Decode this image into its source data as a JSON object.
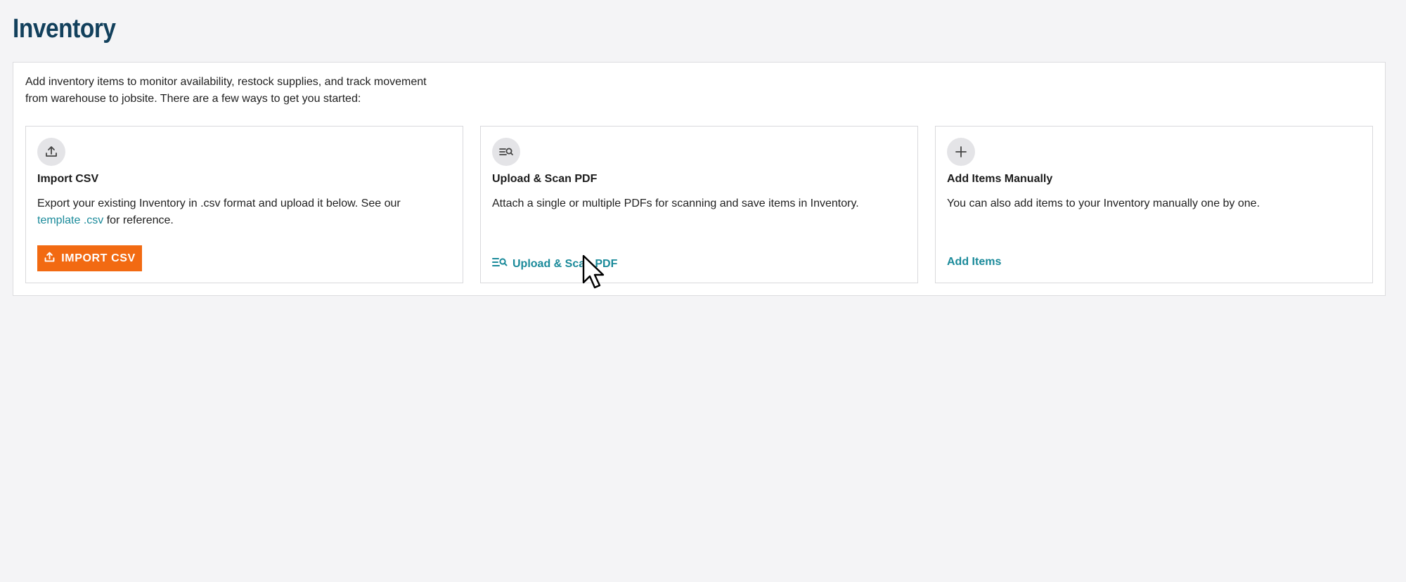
{
  "page": {
    "title": "Inventory"
  },
  "intro": {
    "line1": "Add inventory items to monitor availability, restock supplies, and track movement",
    "line2": "from warehouse to jobsite. There are a few ways to get you started:"
  },
  "cards": {
    "import_csv": {
      "icon": "upload-icon",
      "title": "Import CSV",
      "desc_before_link": "Export your existing Inventory in .csv format and upload it below. See our",
      "link_text": "template .csv",
      "desc_after_link": " for reference.",
      "button_label": "IMPORT CSV",
      "button_icon": "upload-icon"
    },
    "upload_scan": {
      "icon": "scan-list-icon",
      "title": "Upload & Scan PDF",
      "desc": "Attach a single or multiple PDFs for scanning and save items in Inventory.",
      "action_label": "Upload & Scan PDF",
      "action_icon": "scan-list-icon"
    },
    "add_manual": {
      "icon": "plus-icon",
      "title": "Add Items Manually",
      "desc": "You can also add items to your Inventory manually one by one.",
      "action_label": "Add Items"
    }
  },
  "colors": {
    "title": "#12405c",
    "accent_link": "#1a8a9a",
    "primary_button": "#f26a12",
    "background": "#f4f4f6"
  }
}
